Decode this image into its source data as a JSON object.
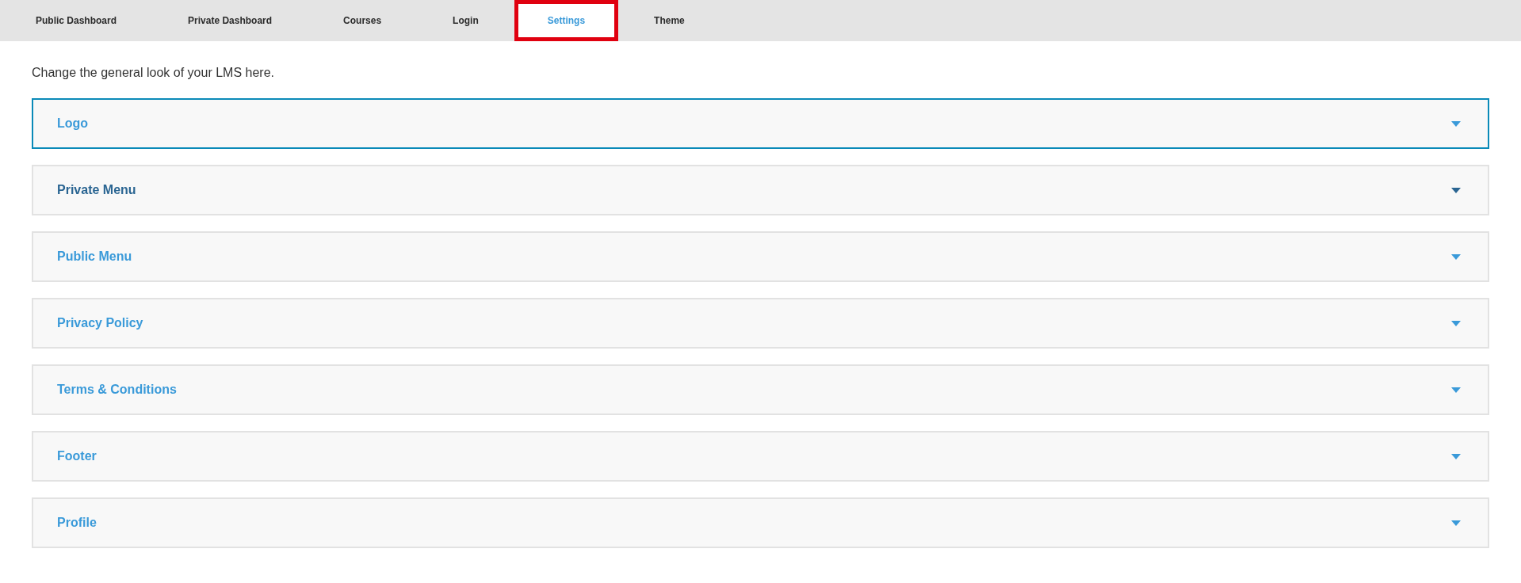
{
  "tabs": [
    {
      "label": "Public Dashboard",
      "selected": false,
      "highlighted": false
    },
    {
      "label": "Private Dashboard",
      "selected": false,
      "highlighted": false
    },
    {
      "label": "Courses",
      "selected": false,
      "highlighted": false
    },
    {
      "label": "Login",
      "selected": false,
      "highlighted": false
    },
    {
      "label": "Settings",
      "selected": true,
      "highlighted": true
    },
    {
      "label": "Theme",
      "selected": false,
      "highlighted": false
    }
  ],
  "intro": "Change the general look of your LMS here.",
  "sections": [
    {
      "title": "Logo",
      "expanded": false,
      "focused": true,
      "hovered": false
    },
    {
      "title": "Private Menu",
      "expanded": false,
      "focused": false,
      "hovered": true
    },
    {
      "title": "Public Menu",
      "expanded": false,
      "focused": false,
      "hovered": false
    },
    {
      "title": "Privacy Policy",
      "expanded": false,
      "focused": false,
      "hovered": false
    },
    {
      "title": "Terms & Conditions",
      "expanded": false,
      "focused": false,
      "hovered": false
    },
    {
      "title": "Footer",
      "expanded": false,
      "focused": false,
      "hovered": false
    },
    {
      "title": "Profile",
      "expanded": false,
      "focused": false,
      "hovered": false
    }
  ]
}
